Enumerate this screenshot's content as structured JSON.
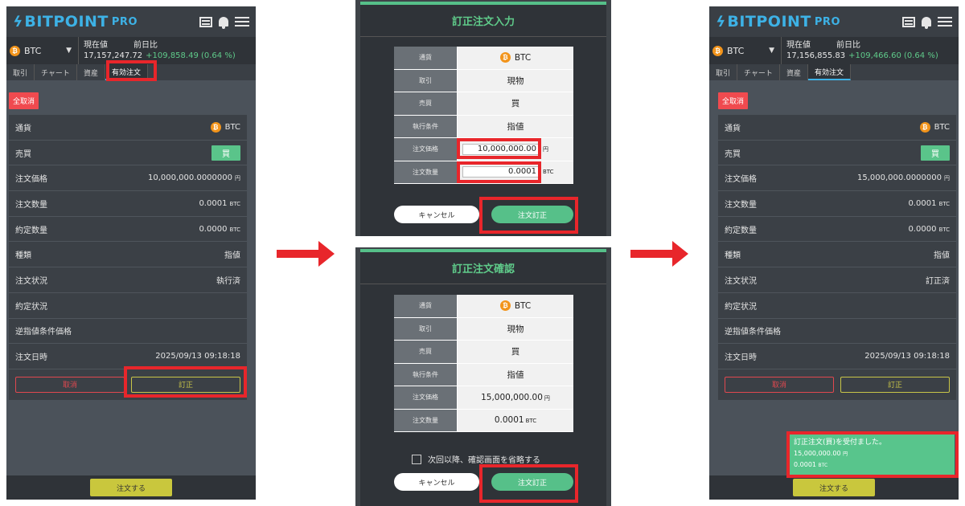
{
  "app": {
    "logo_text": "BITPOINT",
    "logo_pro": "PRO"
  },
  "pricebar": {
    "currency": "BTC",
    "current_label": "現在値",
    "change_label": "前日比"
  },
  "left": {
    "price": "17,157,247.72",
    "change": "+109,858.49 (0.64 %)"
  },
  "right": {
    "price": "17,156,855.83",
    "change": "+109,466.60 (0.64 %)"
  },
  "tabs": [
    "取引",
    "チャート",
    "資産",
    "有効注文"
  ],
  "cancel_all": "全取消",
  "order_rows_labels": {
    "currency": "通貨",
    "side": "売買",
    "order_price": "注文価格",
    "order_qty": "注文数量",
    "filled_qty": "約定数量",
    "type": "種類",
    "status": "注文状況",
    "exec_status": "約定状況",
    "stop_price": "逆指値条件価格",
    "order_time": "注文日時"
  },
  "left_order": {
    "currency": "BTC",
    "side": "買",
    "order_price": "10,000,000.0000000",
    "order_price_unit": "円",
    "order_qty": "0.0001",
    "order_qty_unit": "BTC",
    "filled_qty": "0.0000",
    "filled_qty_unit": "BTC",
    "type": "指値",
    "status": "執行済",
    "order_time": "2025/09/13 09:18:18"
  },
  "right_order": {
    "currency": "BTC",
    "side": "買",
    "order_price": "15,000,000.0000000",
    "order_price_unit": "円",
    "order_qty": "0.0001",
    "order_qty_unit": "BTC",
    "filled_qty": "0.0000",
    "filled_qty_unit": "BTC",
    "type": "指値",
    "status": "訂正済",
    "order_time": "2025/09/13 09:18:18"
  },
  "buttons": {
    "cancel": "取消",
    "edit": "訂正",
    "place_order": "注文する"
  },
  "modal_input": {
    "title": "訂正注文入力",
    "labels": [
      "通貨",
      "取引",
      "売買",
      "執行条件",
      "注文価格",
      "注文数量"
    ],
    "currency": "BTC",
    "trade": "現物",
    "side": "買",
    "condition": "指値",
    "price_value": "10,000,000.00",
    "price_unit": "円",
    "qty_value": "0.0001",
    "qty_unit": "BTC",
    "cancel": "キャンセル",
    "submit": "注文訂正"
  },
  "modal_confirm": {
    "title": "訂正注文確認",
    "labels": [
      "通貨",
      "取引",
      "売買",
      "執行条件",
      "注文価格",
      "注文数量"
    ],
    "currency": "BTC",
    "trade": "現物",
    "side": "買",
    "condition": "指値",
    "price_value": "15,000,000.00",
    "price_unit": "円",
    "qty_value": "0.0001",
    "qty_unit": "BTC",
    "skip_label": "次回以降、確認画面を省略する",
    "cancel": "キャンセル",
    "submit": "注文訂正"
  },
  "toast": {
    "line1": "訂正注文(買)を受付ました。",
    "line2_value": "15,000,000.00",
    "line2_unit": "円",
    "line3_value": "0.0001",
    "line3_unit": "BTC"
  },
  "colors": {
    "accent_blue": "#3db2e6",
    "green": "#56c089",
    "red_highlight": "#e8262b",
    "cancel_red": "#f04a4f",
    "yellow": "#c9c73d"
  }
}
